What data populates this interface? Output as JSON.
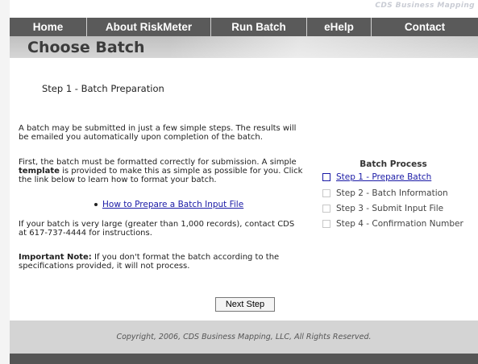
{
  "brand": {
    "text": "CDS Business Mapping"
  },
  "nav": {
    "home": "Home",
    "about": "About RiskMeter",
    "run_batch": "Run Batch",
    "ehelp": "eHelp",
    "contact": "Contact"
  },
  "page": {
    "title": "Choose Batch"
  },
  "main": {
    "step_heading": "Step 1 - Batch Preparation",
    "para1": "A batch may be submitted in just a few simple steps. The results will be emailed you automatically upon completion of the batch.",
    "para2_pre": "First, the batch must be formatted correctly for submission. A simple ",
    "para2_bold": "template",
    "para2_post": " is provided to make this as simple as possible for you. Click the link below to learn how to format your batch.",
    "link_label": "How to Prepare a Batch Input File",
    "para3": "If your batch is very large (greater than 1,000 records), contact CDS at 617-737-4444 for instructions.",
    "note_label": "Important Note:",
    "note_text": " If you don't format the batch according to the specifications provided, it will not process.",
    "next_button": "Next Step"
  },
  "sidebar": {
    "title": "Batch Process",
    "steps": [
      {
        "label": "Step 1 - Prepare Batch",
        "active": true
      },
      {
        "label": "Step 2 - Batch Information",
        "active": false
      },
      {
        "label": "Step 3 - Submit Input File",
        "active": false
      },
      {
        "label": "Step 4 - Confirmation Number",
        "active": false
      }
    ]
  },
  "footer": {
    "copyright": "Copyright, 2006, CDS Business Mapping, LLC, All Rights Reserved."
  },
  "colors": {
    "nav_bg": "#5a5a5a",
    "title_bar": "#c8c8c8",
    "link": "#1a1aa6",
    "footer_bg": "#d4d4d4",
    "footer_bar": "#555555"
  }
}
